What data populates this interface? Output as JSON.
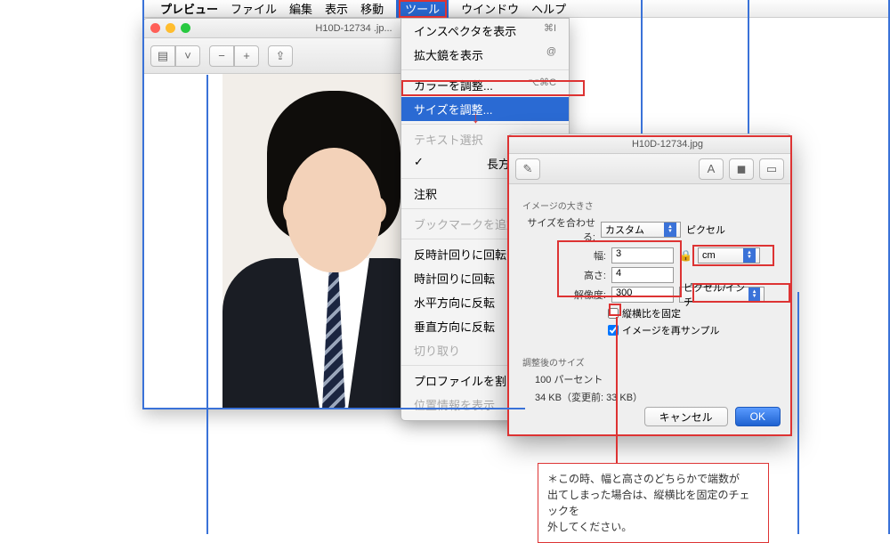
{
  "menubar": {
    "app": "プレビュー",
    "items": [
      "ファイル",
      "編集",
      "表示",
      "移動"
    ],
    "selected": "ツール",
    "right": [
      "ウインドウ",
      "ヘルプ"
    ]
  },
  "window": {
    "title": "H10D-12734 .jp..."
  },
  "menu": {
    "inspector": "インスペクタを表示",
    "inspector_sc": "⌘I",
    "magnifier": "拡大鏡を表示",
    "magnifier_sc": "@",
    "color": "カラーを調整...",
    "color_sc": "⌥⌘C",
    "size": "サイズを調整...",
    "text_sel": "テキスト選択",
    "rect_sel": "長方形で選択",
    "annotate": "注釈",
    "bookmark": "ブックマークを追加",
    "rot_ccw": "反時計回りに回転",
    "rot_cw": "時計回りに回転",
    "flip_h": "水平方向に反転",
    "flip_v": "垂直方向に反転",
    "crop": "切り取り",
    "profile": "プロファイルを割り当",
    "geo": "位置情報を表示"
  },
  "dialog": {
    "title": "H10D-12734.jpg",
    "section_size": "イメージの大きさ",
    "fit_label": "サイズを合わせる:",
    "fit_value": "カスタム",
    "fit_unit_after": "ピクセル",
    "width_label": "幅:",
    "width_value": "3",
    "height_label": "高さ:",
    "height_value": "4",
    "unit_select": "cm",
    "res_label": "解像度:",
    "res_value": "300",
    "res_unit": "ピクセル/インチ",
    "chk_aspect": "縦横比を固定",
    "chk_resample": "イメージを再サンプル",
    "section_result": "調整後のサイズ",
    "result_percent": "100 パーセント",
    "result_size": "34 KB（変更前: 33 KB）",
    "cancel": "キャンセル",
    "ok": "OK"
  },
  "callout": {
    "line1": "＊この時、幅と高さのどちらかで端数が",
    "line2": "出てしまった場合は、縦横比を固定のチェックを",
    "line3": "外してください。"
  }
}
